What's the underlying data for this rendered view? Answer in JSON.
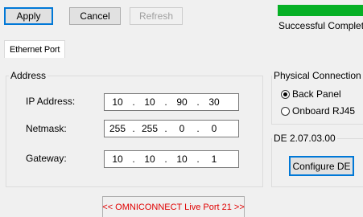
{
  "toolbar": {
    "apply_label": "Apply",
    "cancel_label": "Cancel",
    "refresh_label": "Refresh"
  },
  "progress": {
    "fraction": 1.0,
    "color": "#06b025",
    "status_text": "Successful Completi"
  },
  "tabs": [
    {
      "label": "Ethernet Port",
      "selected": true
    }
  ],
  "address": {
    "legend": "Address",
    "ip_label": "IP Address:",
    "ip": [
      "10",
      "10",
      "90",
      "30"
    ],
    "netmask_label": "Netmask:",
    "netmask": [
      "255",
      "255",
      "0",
      "0"
    ],
    "gateway_label": "Gateway:",
    "gateway": [
      "10",
      "10",
      "10",
      "1"
    ],
    "separator": "."
  },
  "physical_connection": {
    "legend": "Physical Connection",
    "options": [
      {
        "label": "Back Panel",
        "selected": true
      },
      {
        "label": "Onboard RJ45",
        "selected": false
      }
    ]
  },
  "de": {
    "legend": "DE 2.07.03.00",
    "configure_label": "Configure DE"
  },
  "banner": {
    "text": "<< OMNICONNECT Live Port 21 >>",
    "color": "#e00000"
  }
}
